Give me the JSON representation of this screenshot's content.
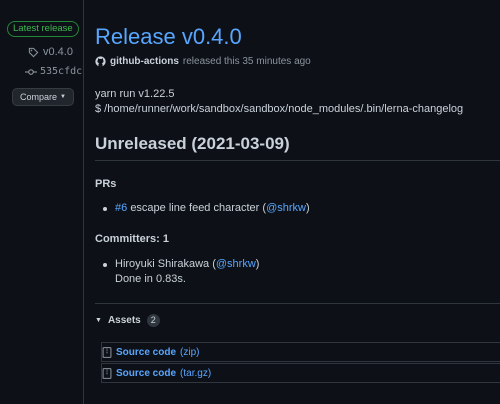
{
  "sidebar": {
    "badge": "Latest release",
    "tag": "v0.4.0",
    "commit": "535cfdc",
    "compare_label": "Compare"
  },
  "release": {
    "title": "Release v0.4.0",
    "author": "github-actions",
    "released_text": "released this 35 minutes ago",
    "command_line_1": "yarn run v1.22.5",
    "command_line_2": "$ /home/runner/work/sandbox/sandbox/node_modules/.bin/lerna-changelog",
    "heading": "Unreleased (2021-03-09)",
    "prs_label": "PRs",
    "pr_link": "#6",
    "pr_text": "escape line feed character (",
    "pr_user": "@shrkw",
    "pr_close": ")",
    "committers_label": "Committers: 1",
    "committer_name": "Hiroyuki Shirakawa (",
    "committer_user": "@shrkw",
    "committer_close": ")",
    "done_text": "Done in 0.83s."
  },
  "assets": {
    "label": "Assets",
    "count": "2",
    "items": [
      {
        "name": "Source code",
        "format": "(zip)"
      },
      {
        "name": "Source code",
        "format": "(tar.gz)"
      }
    ]
  },
  "colors": {
    "background": "#0d1117",
    "link": "#58a6ff",
    "badge_green": "#3fb950",
    "border": "#30363d"
  }
}
